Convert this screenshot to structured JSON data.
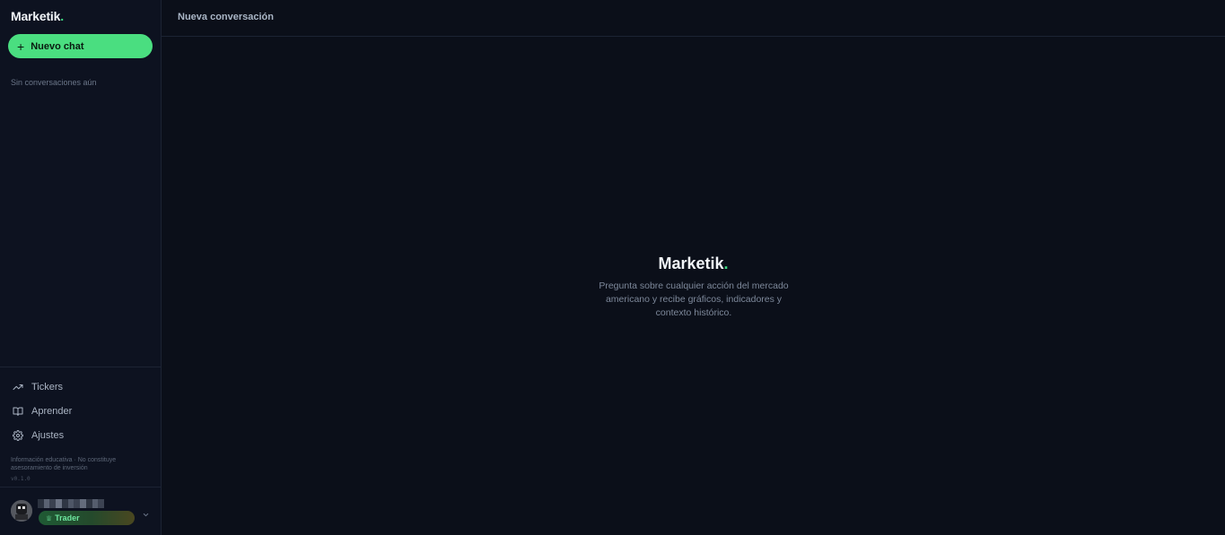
{
  "sidebar": {
    "brand": {
      "name": "Marketik",
      "dot": "."
    },
    "new_chat": {
      "icon": "plus-icon",
      "label": "Nuevo chat"
    },
    "empty_state": "Sin conversaciones aún",
    "nav": [
      {
        "icon": "trending-up-icon",
        "label": "Tickers"
      },
      {
        "icon": "book-open-icon",
        "label": "Aprender"
      },
      {
        "icon": "gear-icon",
        "label": "Ajustes"
      }
    ],
    "disclaimer": "Información educativa · No constituye asesoramiento de inversión",
    "version": "v0.1.0",
    "user": {
      "plan_badge": "Trader",
      "plan_icon": "crown-icon"
    }
  },
  "header": {
    "title": "Nueva conversación"
  },
  "main": {
    "brand": {
      "name": "Marketik",
      "dot": "."
    },
    "description": "Pregunta sobre cualquier acción del mercado americano y recibe gráficos, indicadores y contexto histórico."
  },
  "colors": {
    "background": "#0b0f19",
    "sidebar": "#0d1220",
    "accent": "#4ade80",
    "text_muted": "#7d889a"
  }
}
